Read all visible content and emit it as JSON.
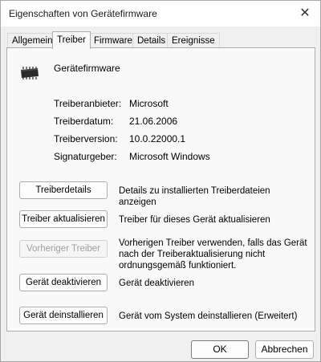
{
  "window": {
    "title": "Eigenschaften von Gerätefirmware",
    "close_glyph": "✕"
  },
  "tabs": [
    {
      "label": "Allgemein"
    },
    {
      "label": "Treiber"
    },
    {
      "label": "Firmware"
    },
    {
      "label": "Details"
    },
    {
      "label": "Ereignisse"
    }
  ],
  "active_tab": "Treiber",
  "device": {
    "name": "Gerätefirmware",
    "icon": "chip-icon"
  },
  "properties": {
    "provider": {
      "label": "Treiberanbieter:",
      "value": "Microsoft"
    },
    "date": {
      "label": "Treiberdatum:",
      "value": "21.06.2006"
    },
    "version": {
      "label": "Treiberversion:",
      "value": "10.0.22000.1"
    },
    "signer": {
      "label": "Signaturgeber:",
      "value": "Microsoft Windows"
    }
  },
  "actions": {
    "details": {
      "label": "Treiberdetails",
      "desc": "Details zu installierten Treiberdateien anzeigen"
    },
    "update": {
      "label": "Treiber aktualisieren",
      "desc": "Treiber für dieses Gerät aktualisieren"
    },
    "rollback": {
      "label": "Vorheriger Treiber",
      "desc": "Vorherigen Treiber verwenden, falls das Gerät nach der Treiberaktualisierung nicht ordnungsgemäß funktioniert.",
      "enabled": false
    },
    "disable": {
      "label": "Gerät deaktivieren",
      "desc": "Gerät deaktivieren"
    },
    "uninstall": {
      "label": "Gerät deinstallieren",
      "desc": "Gerät vom System deinstallieren (Erweitert)"
    }
  },
  "footer": {
    "ok_label": "OK",
    "cancel_label": "Abbrechen"
  }
}
